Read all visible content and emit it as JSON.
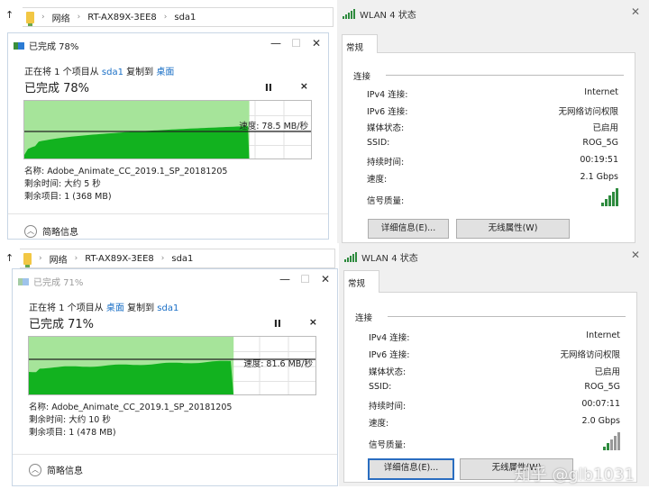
{
  "sessions": [
    {
      "breadcrumb": [
        "网络",
        "RT-AX89X-3EE8",
        "sda1"
      ],
      "copy": {
        "title": "已完成 78%",
        "prefix": "正在将 1 个项目从 ",
        "src": "sda1",
        "mid": " 复制到 ",
        "dst": "桌面",
        "heading": "已完成 78%",
        "progress": 0.78,
        "speed": "速度: 78.5 MB/秒",
        "name": "名称: Adobe_Animate_CC_2019.1_SP_20181205",
        "time_left": "剩余时间: 大约 5 秒",
        "items_left": "剩余项目: 1 (368 MB)",
        "more": "简略信息",
        "pause": "II",
        "cancel": "×"
      },
      "wlan": {
        "title": "WLAN 4 状态",
        "tab": "常规",
        "group": "连接",
        "rows": [
          [
            "IPv4 连接:",
            "Internet"
          ],
          [
            "IPv6 连接:",
            "无网络访问权限"
          ],
          [
            "媒体状态:",
            "已启用"
          ],
          [
            "SSID:",
            "ROG_5G"
          ],
          [
            "持续时间:",
            "00:19:51"
          ],
          [
            "速度:",
            "2.1 Gbps"
          ]
        ],
        "signal_label": "信号质量:",
        "signal_bars": 5,
        "details_btn": "详细信息(E)...",
        "wireless_btn": "无线属性(W)"
      }
    },
    {
      "breadcrumb": [
        "网络",
        "RT-AX89X-3EE8",
        "sda1"
      ],
      "copy": {
        "title": "已完成 71%",
        "prefix": "正在将 1 个项目从 ",
        "src": "桌面",
        "mid": " 复制到 ",
        "dst": "sda1",
        "heading": "已完成 71%",
        "progress": 0.71,
        "speed": "速度: 81.6 MB/秒",
        "name": "名称: Adobe_Animate_CC_2019.1_SP_20181205",
        "time_left": "剩余时间: 大约 10 秒",
        "items_left": "剩余项目: 1 (478 MB)",
        "more": "简略信息",
        "pause": "II",
        "cancel": "×"
      },
      "wlan": {
        "title": "WLAN 4 状态",
        "tab": "常规",
        "group": "连接",
        "rows": [
          [
            "IPv4 连接:",
            "Internet"
          ],
          [
            "IPv6 连接:",
            "无网络访问权限"
          ],
          [
            "媒体状态:",
            "已启用"
          ],
          [
            "SSID:",
            "ROG_5G"
          ],
          [
            "持续时间:",
            "00:07:11"
          ],
          [
            "速度:",
            "2.0 Gbps"
          ]
        ],
        "signal_label": "信号质量:",
        "signal_bars": 2,
        "details_btn": "详细信息(E)...",
        "wireless_btn": "无线属性(W)"
      }
    }
  ],
  "watermark": "知乎 @glb1031",
  "colors": {
    "fill_light": "#a6e49a",
    "fill_dark": "#12b21f",
    "link": "#1a6fc6",
    "signal": "#2e8b3e"
  }
}
